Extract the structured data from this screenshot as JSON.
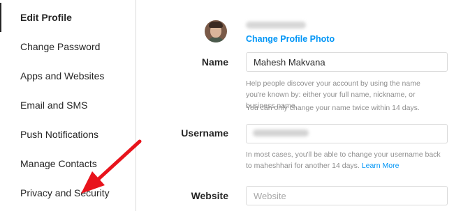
{
  "sidebar": {
    "items": [
      {
        "label": "Edit Profile"
      },
      {
        "label": "Change Password"
      },
      {
        "label": "Apps and Websites"
      },
      {
        "label": "Email and SMS"
      },
      {
        "label": "Push Notifications"
      },
      {
        "label": "Manage Contacts"
      },
      {
        "label": "Privacy and Security"
      }
    ]
  },
  "profile": {
    "change_photo_label": "Change Profile Photo"
  },
  "form": {
    "name": {
      "label": "Name",
      "value": "Mahesh Makvana",
      "help1": "Help people discover your account by using the name you're known by: either your full name, nickname, or business name.",
      "help2": "You can only change your name twice within 14 days."
    },
    "username": {
      "label": "Username",
      "help": "In most cases, you'll be able to change your username back to maheshhari for another 14 days.",
      "learn_more": "Learn More"
    },
    "website": {
      "label": "Website",
      "placeholder": "Website"
    }
  },
  "colors": {
    "accent": "#0095f6",
    "annotation_arrow": "#e8141c"
  }
}
